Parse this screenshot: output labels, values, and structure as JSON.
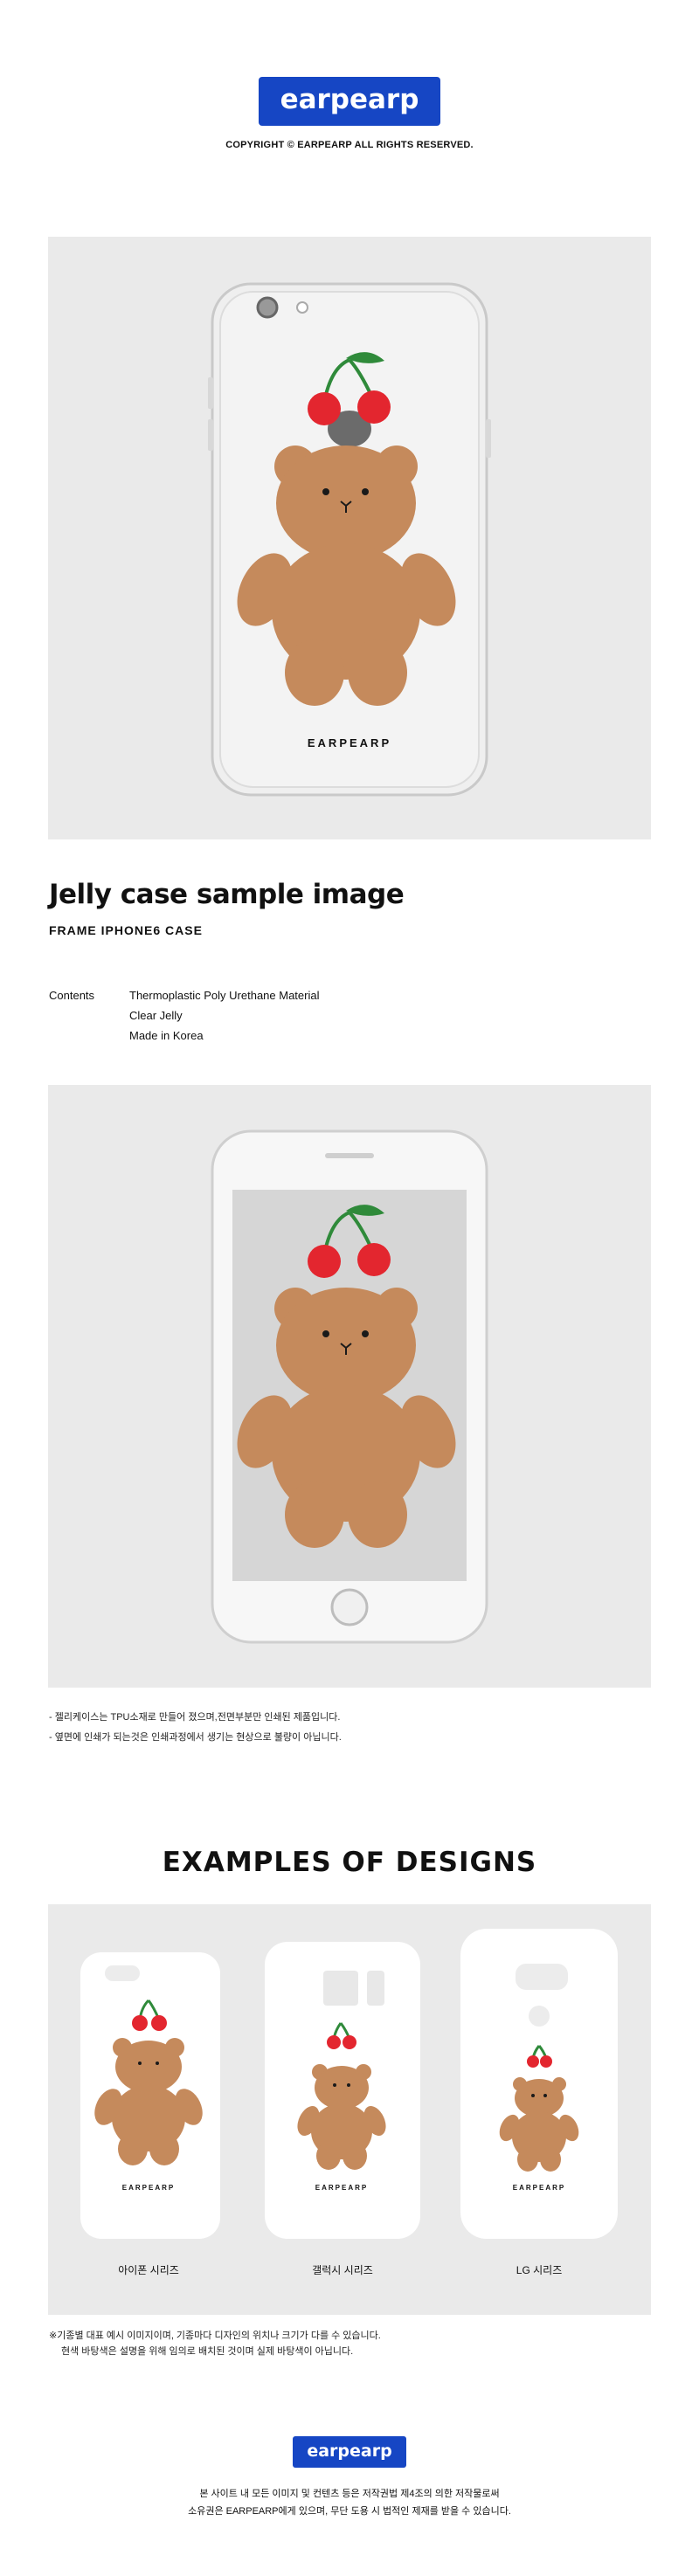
{
  "brand": {
    "logo_text": "earpearp",
    "copyright": "COPYRIGHT © EARPEARP ALL RIGHTS RESERVED.",
    "accent": "#1646c4"
  },
  "hero": {
    "case_brand_text": "EARPEARP"
  },
  "product": {
    "title": "Jelly case sample image",
    "subtitle": "FRAME IPHONE6 CASE",
    "contents_label": "Contents",
    "contents": [
      "Thermoplastic Poly Urethane Material",
      "Clear Jelly",
      "Made in Korea"
    ]
  },
  "notes": [
    "- 젤리케이스는 TPU소재로 만들어 졌으며,전면부분만 인쇄된 제품입니다.",
    "- 옆면에 인쇄가 되는것은 인쇄과정에서 생기는 현상으로 불량이 아닙니다."
  ],
  "examples": {
    "title": "EXAMPLES OF DESIGNS",
    "captions": [
      "아이폰 시리즈",
      "갤럭시 시리즈",
      "LG 시리즈"
    ],
    "case_brand_text": "EARPEARP",
    "notes": [
      "※기종별 대표 예시 이미지이며, 기종마다 디자인의 위치나 크기가 다를 수 있습니다.",
      "현색 바탕색은 설명을 위해 임의로 배치된 것이며 실제 바탕색이 아닙니다."
    ]
  },
  "footer": {
    "logo_text": "earpearp",
    "lines": [
      "본 사이트 내 모든 이미지 및 컨텐츠 등은 저작권법 제4조의 의한 저작물로써",
      "소유권은 EARPEARP에게 있으며, 무단 도용 시 법적인 제재를 받을 수 있습니다."
    ]
  },
  "colors": {
    "bear": "#c58a5c",
    "cherry": "#e3262f",
    "leaf": "#2f8a3a",
    "panel": "#eaeaea"
  }
}
